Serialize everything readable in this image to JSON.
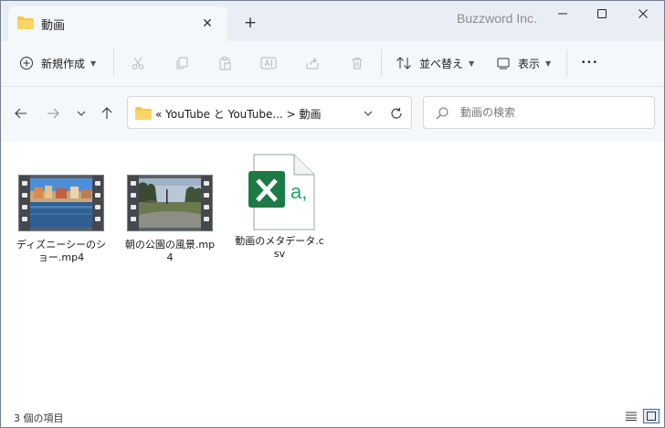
{
  "titlebar": {
    "tab_title": "動画",
    "tab_icon": "folder-icon",
    "close_tab_glyph": "✕",
    "new_tab_glyph": "+",
    "brand": "Buzzword Inc.",
    "minimize_glyph": "—",
    "maximize_glyph": "☐",
    "close_glyph": "✕"
  },
  "toolbar": {
    "new_label": "新規作成",
    "sort_label": "並べ替え",
    "view_label": "表示",
    "more_glyph": "•••",
    "disabled_icons": [
      "cut-icon",
      "copy-icon",
      "paste-icon",
      "rename-icon",
      "share-icon",
      "delete-icon"
    ]
  },
  "navigation": {
    "address_path": "« YouTube と YouTube...  >  動画",
    "search_placeholder": "動画の検索"
  },
  "files": [
    {
      "name": "ディズニーシーのショー.mp4",
      "type": "video"
    },
    {
      "name": "朝の公園の風景.mp4",
      "type": "video"
    },
    {
      "name": "動画のメタデータ.csv",
      "type": "excel"
    }
  ],
  "statusbar": {
    "item_count": "3 個の項目"
  },
  "colors": {
    "chrome_bg": "#f5f8fb",
    "titlebar_bg": "#e9eef4",
    "folder_yellow": "#f8c647",
    "excel_green": "#1d7a45"
  }
}
